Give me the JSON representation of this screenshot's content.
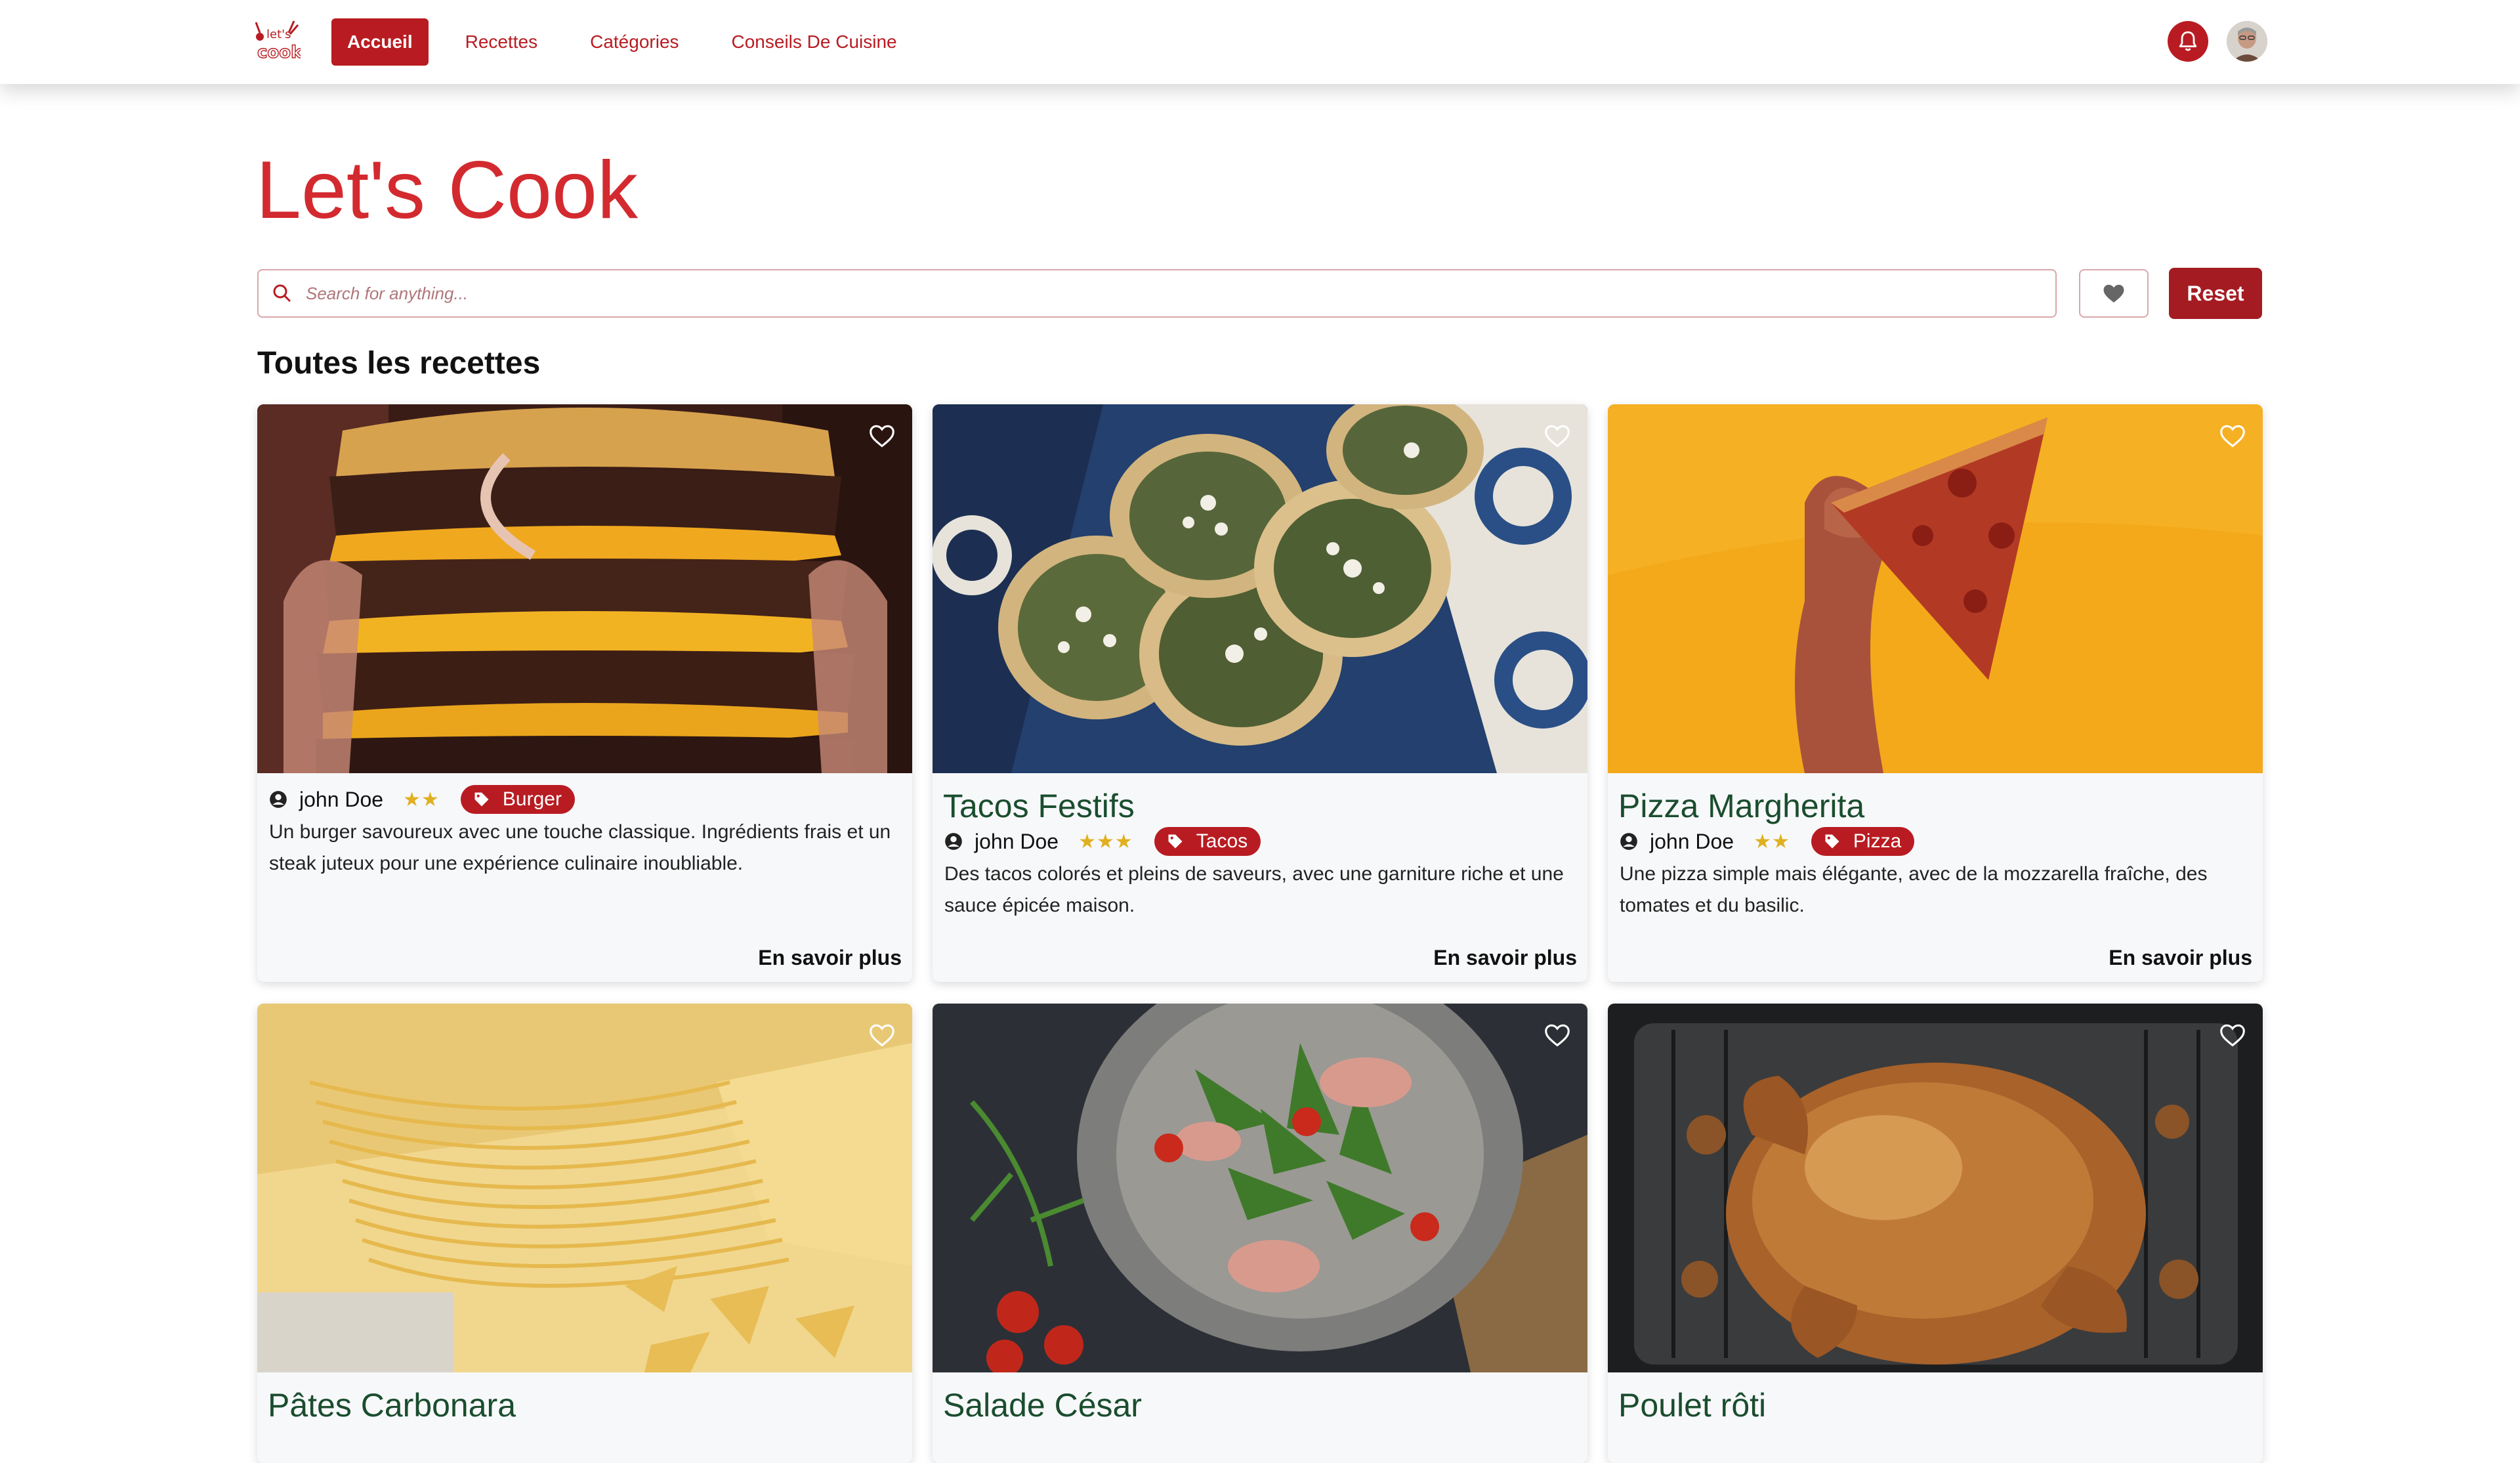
{
  "nav": {
    "logo_text": "let's cook",
    "links": [
      "Accueil",
      "Recettes",
      "Catégories",
      "Conseils De Cuisine"
    ],
    "active_index": 0
  },
  "hero": {
    "title": "Let's Cook"
  },
  "search": {
    "placeholder": "Search for anything...",
    "value": ""
  },
  "buttons": {
    "reset": "Reset"
  },
  "section": {
    "title": "Toutes les recettes"
  },
  "colors": {
    "brand": "#b81c22",
    "title_green": "#1a4d2e",
    "star": "#e0b020"
  },
  "recipes": [
    {
      "title": "",
      "author": "john Doe",
      "rating": 2,
      "stars": "★★",
      "tag": "Burger",
      "description": "Un burger savoureux avec une touche classique. Ingrédients frais et un steak juteux pour une expérience culinaire inoubliable.",
      "more": "En savoir plus",
      "image": "burger-photo"
    },
    {
      "title": "Tacos Festifs",
      "author": "john Doe",
      "rating": 3,
      "stars": "★★★",
      "tag": "Tacos",
      "description": "Des tacos colorés et pleins de saveurs, avec une garniture riche et une sauce épicée maison.",
      "more": "En savoir plus",
      "image": "tacos-photo"
    },
    {
      "title": "Pizza Margherita",
      "author": "john Doe",
      "rating": 2,
      "stars": "★★",
      "tag": "Pizza",
      "description": "Une pizza simple mais élégante, avec de la mozzarella fraîche, des tomates et du basilic.",
      "more": "En savoir plus",
      "image": "pizza-photo"
    },
    {
      "title": "Pâtes Carbonara",
      "image": "pasta-photo"
    },
    {
      "title": "Salade César",
      "image": "salad-photo"
    },
    {
      "title": "Poulet rôti",
      "image": "chicken-photo"
    }
  ]
}
